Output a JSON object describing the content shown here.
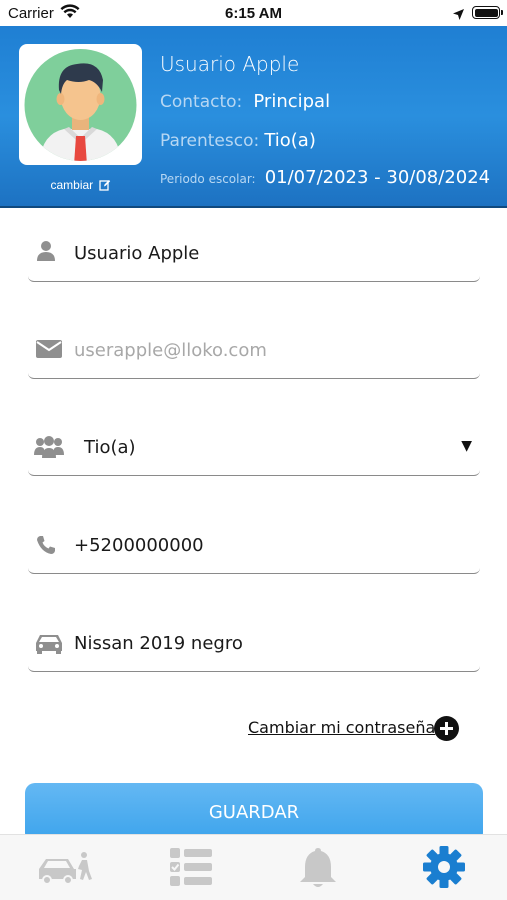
{
  "status_bar": {
    "carrier": "Carrier",
    "time": "6:15 AM"
  },
  "header": {
    "name": "Usuario Apple",
    "contact_label": "Contacto:",
    "contact_value": "Principal",
    "relation_label": "Parentesco:",
    "relation_value": "Tio(a)",
    "period_label": "Periodo escolar:",
    "period_value": "01/07/2023 - 30/08/2024",
    "change_label": "cambiar"
  },
  "form": {
    "name": "Usuario Apple",
    "email_placeholder": "userapple@lloko.com",
    "relation": "Tio(a)",
    "phone": "+5200000000",
    "vehicle": "Nissan 2019 negro"
  },
  "change_password_label": "Cambiar mi contraseña",
  "save_label": "GUARDAR",
  "tabs": [
    {
      "icon": "car-pickup-icon",
      "active": false
    },
    {
      "icon": "checklist-icon",
      "active": false
    },
    {
      "icon": "bell-icon",
      "active": false
    },
    {
      "icon": "gear-icon",
      "active": true
    }
  ],
  "colors": {
    "header_blue": "#1f7fd3",
    "button_blue": "#3ba3ec",
    "active_tab": "#1a7ed0",
    "inactive_tab": "#c8c8c8"
  }
}
